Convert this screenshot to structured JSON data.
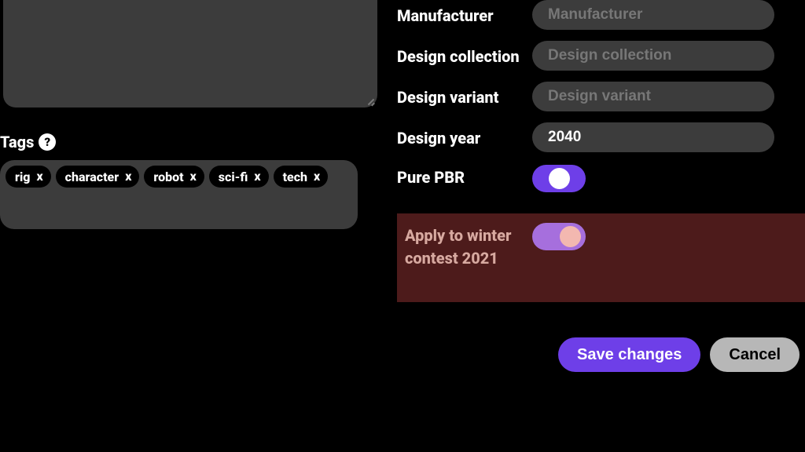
{
  "left": {
    "tags_label": "Tags",
    "tags": [
      "rig",
      "character",
      "robot",
      "sci-fi",
      "tech"
    ],
    "remove_glyph": "x"
  },
  "right": {
    "manufacturer": {
      "label": "Manufacturer",
      "placeholder": "Manufacturer",
      "value": ""
    },
    "design_collection": {
      "label": "Design collection",
      "placeholder": "Design collection",
      "value": ""
    },
    "design_variant": {
      "label": "Design variant",
      "placeholder": "Design variant",
      "value": ""
    },
    "design_year": {
      "label": "Design year",
      "placeholder": "",
      "value": "2040"
    },
    "pure_pbr": {
      "label": "Pure PBR",
      "on": true
    },
    "apply_contest": {
      "label": "Apply to winter contest 2021",
      "on": true
    }
  },
  "footer": {
    "save_label": "Save changes",
    "cancel_label": "Cancel"
  },
  "help_glyph": "?"
}
